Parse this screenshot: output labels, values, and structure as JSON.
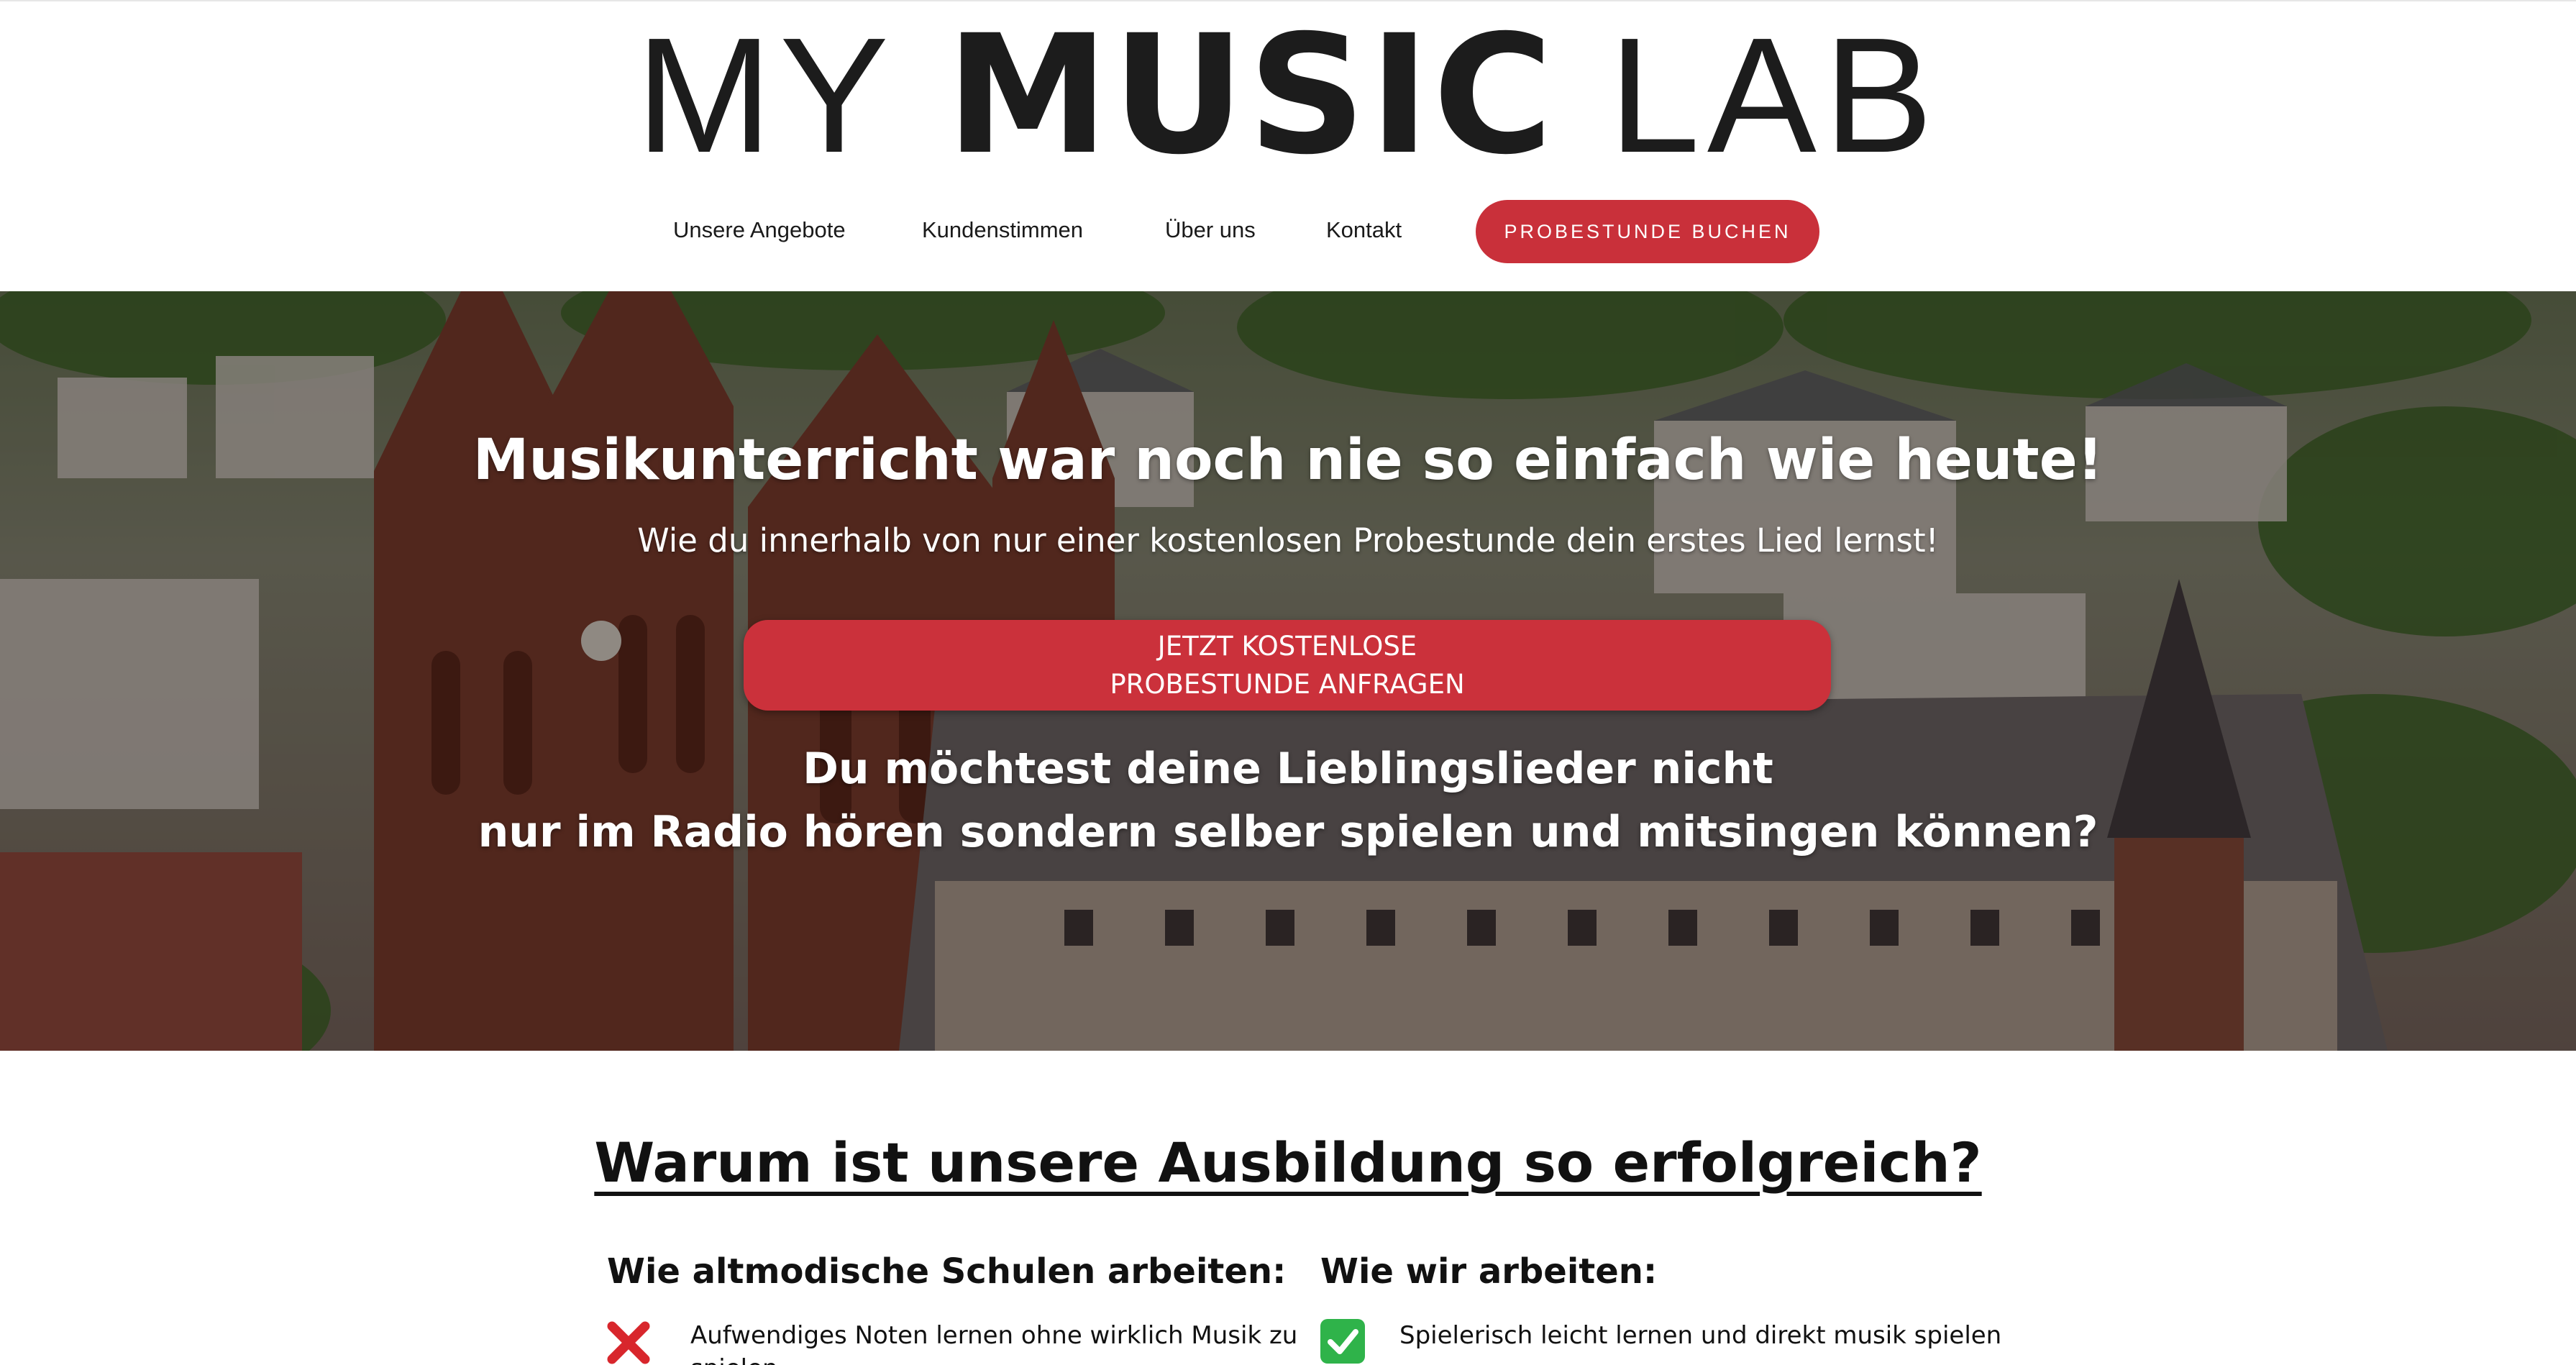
{
  "header": {
    "logo": {
      "part1": "MY ",
      "part2": "MUSIC",
      "part3": " LAB"
    },
    "nav": [
      {
        "label": "Unsere Angebote"
      },
      {
        "label": "Kundenstimmen"
      },
      {
        "label": "Über uns"
      },
      {
        "label": "Kontakt"
      }
    ],
    "cta_label": "PROBESTUNDE BUCHEN"
  },
  "hero": {
    "title": "Musikunterricht war noch nie so einfach wie heute!",
    "subtitle": "Wie du innerhalb von nur einer kostenlosen Probestunde dein erstes Lied lernst!",
    "cta_line1": "JETZT KOSTENLOSE",
    "cta_line2": "PROBESTUNDE ANFRAGEN",
    "question_line1": "Du möchtest deine Lieblingslieder nicht",
    "question_line2": "nur im Radio hören sondern selber spielen und mitsingen können?"
  },
  "why": {
    "title": "Warum ist unsere Ausbildung so erfolgreich?",
    "old": {
      "heading": "Wie altmodische Schulen arbeiten:",
      "items": [
        {
          "text": "Aufwendiges Noten lernen ohne wirklich Musik zu spielen",
          "icon": "cross-mark-icon"
        }
      ]
    },
    "new": {
      "heading": "Wie wir arbeiten:",
      "items": [
        {
          "text": "Spielerisch leicht lernen und direkt musik spielen",
          "icon": "check-mark-icon"
        }
      ]
    }
  },
  "colors": {
    "accent": "#c9303a",
    "text": "#111111",
    "check": "#2fb34a",
    "cross": "#d8262c"
  }
}
